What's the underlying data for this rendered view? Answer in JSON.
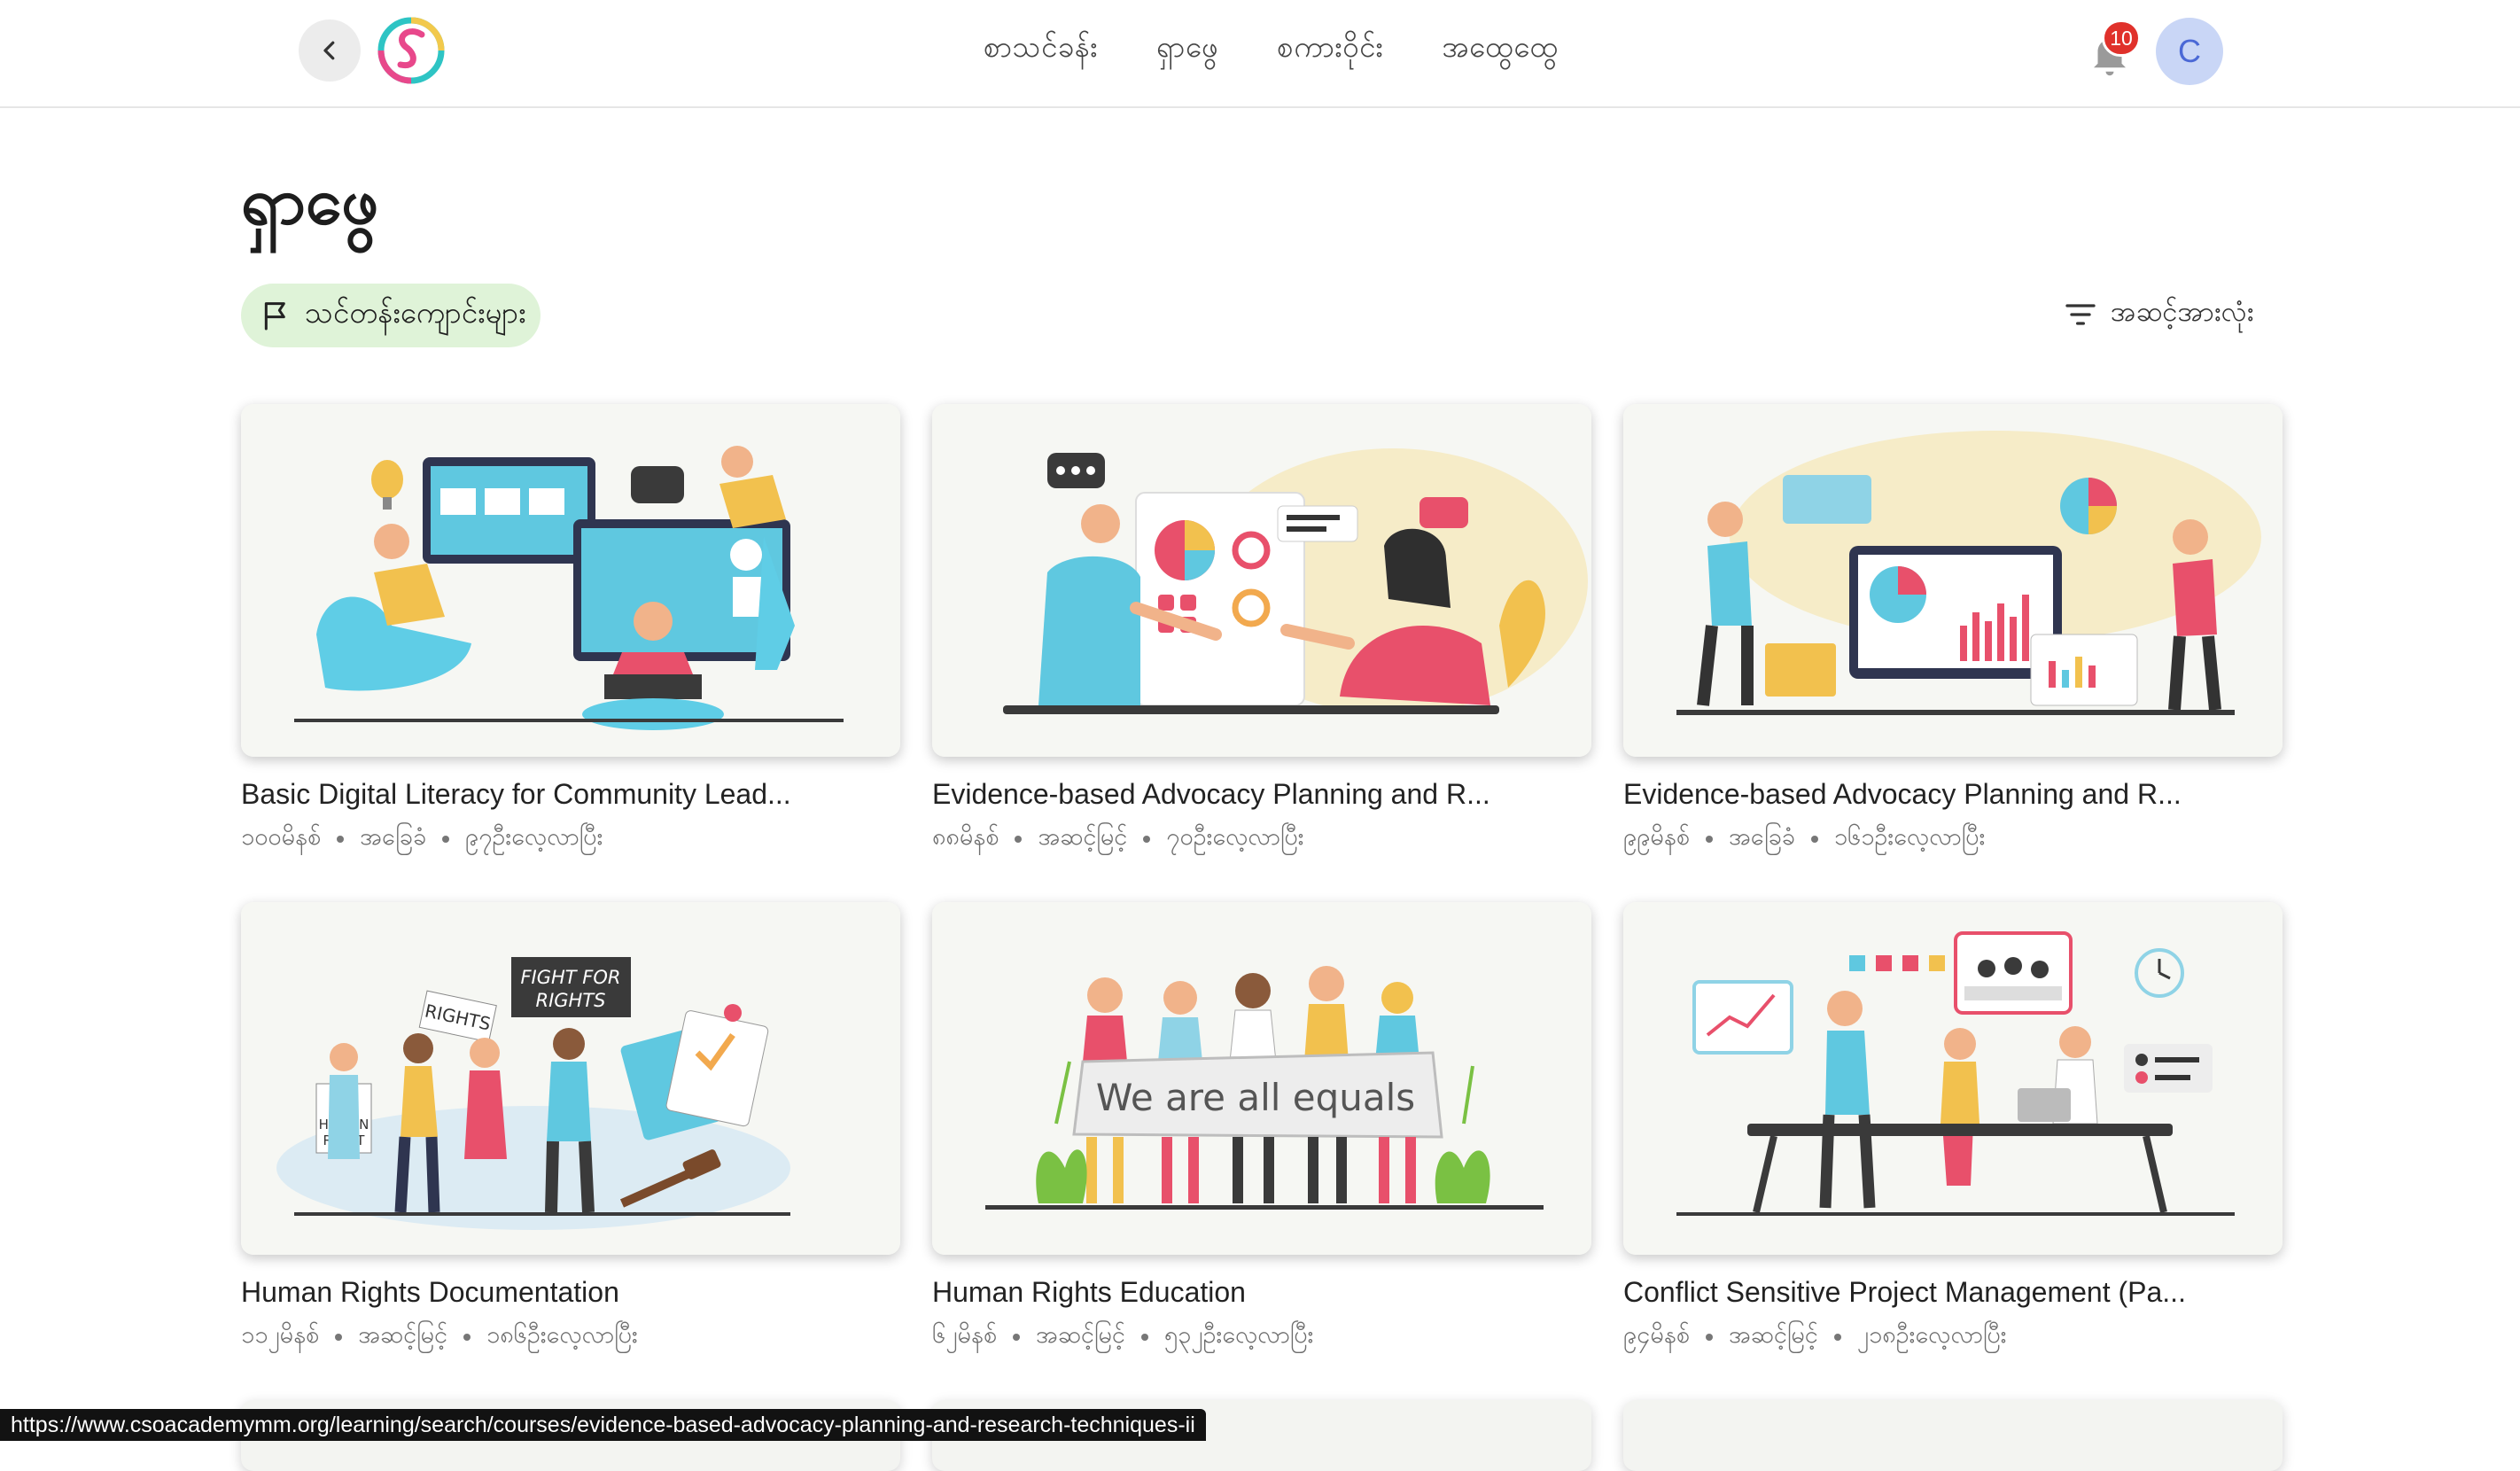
{
  "header": {
    "nav": [
      "စာသင်ခန်း",
      "ရှာဖွေ",
      "စကားဝိုင်း",
      "အထွေထွေ"
    ],
    "notification_count": "10",
    "avatar_initial": "C"
  },
  "page": {
    "title": "ရှာဖွေ",
    "filter_label": "သင်တန်းကျောင်းများ",
    "sort_label": "အဆင့်အားလုံး"
  },
  "courses": [
    {
      "title": "Basic Digital Literacy for Community Lead...",
      "duration": "၁၀၀မိနစ်",
      "level": "အခြေခံ",
      "learners": "၉၇ဦးလေ့လာပြီး"
    },
    {
      "title": "Evidence-based Advocacy Planning and R...",
      "duration": "၈၈မိနစ်",
      "level": "အဆင့်မြင့်",
      "learners": "၇၀ဦးလေ့လာပြီး"
    },
    {
      "title": "Evidence-based Advocacy Planning and R...",
      "duration": "၉၉မိနစ်",
      "level": "အခြေခံ",
      "learners": "၁၆၁ဦးလေ့လာပြီး"
    },
    {
      "title": "Human Rights Documentation",
      "duration": "၁၁၂မိနစ်",
      "level": "အဆင့်မြင့်",
      "learners": "၁၈၆ဦးလေ့လာပြီး"
    },
    {
      "title": "Human Rights Education",
      "duration": "၆၂မိနစ်",
      "level": "အဆင့်မြင့်",
      "learners": "၅၃၂ဦးလေ့လာပြီး"
    },
    {
      "title": "Conflict Sensitive Project Management (Pa...",
      "duration": "၉၄မိနစ်",
      "level": "အဆင့်မြင့်",
      "learners": "၂၁၈ဦးလေ့လာပြီး"
    }
  ],
  "illustration_text": {
    "sign_fight": "FIGHT FOR RIGHTS",
    "sign_rights": "RIGHTS",
    "sign_human": "HUMAN RIGHT",
    "banner": "We are all equals"
  },
  "status_url": "https://www.csoacademymm.org/learning/search/courses/evidence-based-advocacy-planning-and-research-techniques-ii",
  "colors": {
    "accent_chip": "#dff3d8",
    "badge": "#e0312b",
    "avatar_bg": "#c9d6f6",
    "avatar_text": "#4a68d6"
  },
  "icons": [
    "chevron-left-icon",
    "logo-icon",
    "bell-icon",
    "flag-icon",
    "filter-icon"
  ]
}
